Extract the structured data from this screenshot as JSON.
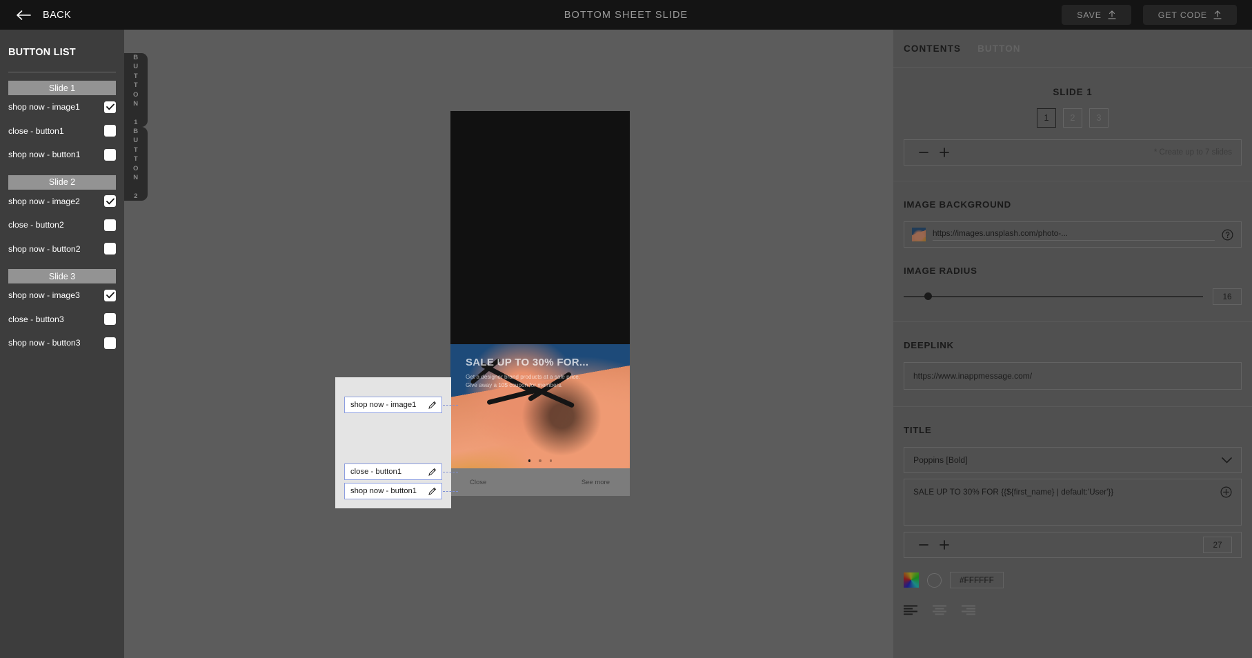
{
  "topbar": {
    "back_label": "BACK",
    "title": "BOTTOM SHEET SLIDE",
    "save_label": "SAVE",
    "get_code_label": "GET CODE"
  },
  "sidebar": {
    "title": "BUTTON LIST",
    "groups": [
      {
        "slide_label": "Slide 1",
        "items": [
          {
            "label": "shop now - image1",
            "checked": true
          },
          {
            "label": "close - button1",
            "checked": false
          },
          {
            "label": "shop now - button1",
            "checked": false
          }
        ]
      },
      {
        "slide_label": "Slide 2",
        "items": [
          {
            "label": "shop now - image2",
            "checked": true
          },
          {
            "label": "close - button2",
            "checked": false
          },
          {
            "label": "shop now - button2",
            "checked": false
          }
        ]
      },
      {
        "slide_label": "Slide 3",
        "items": [
          {
            "label": "shop now - image3",
            "checked": true
          },
          {
            "label": "close - button3",
            "checked": false
          },
          {
            "label": "shop now - button3",
            "checked": false
          }
        ]
      }
    ]
  },
  "vtabs": [
    {
      "label": "BUTTON 1"
    },
    {
      "label": "BUTTON 2"
    }
  ],
  "preview": {
    "headline": "SALE UP TO 30% FOR",
    "headline_suffix": "...",
    "body_line1": "Get a designer brand products at a sale price.",
    "body_line2": "Give away a 10$ coupon for members.",
    "close_label": "Close",
    "more_label": "See more",
    "dot_count": 3,
    "active_dot": 0
  },
  "popup": {
    "fields": [
      {
        "label": "shop now - image1"
      },
      {
        "label": "close - button1"
      },
      {
        "label": "shop now - button1"
      }
    ]
  },
  "right": {
    "tabs": [
      {
        "label": "CONTENTS",
        "active": true
      },
      {
        "label": "BUTTON",
        "active": false
      }
    ],
    "slide_section": {
      "title": "SLIDE 1",
      "numbers": [
        "1",
        "2",
        "3"
      ],
      "active_number": "1",
      "note": "* Create up to 7 slides"
    },
    "image_background": {
      "title": "IMAGE BACKGROUND",
      "url": "https://images.unsplash.com/photo-...",
      "help_icon": "question-circle-icon"
    },
    "image_radius": {
      "title": "IMAGE RADIUS",
      "value": "16"
    },
    "deeplink": {
      "title": "DEEPLINK",
      "url": "https://www.inappmessage.com/"
    },
    "title_section": {
      "title": "TITLE",
      "font": "Poppins [Bold]",
      "text": "SALE UP TO 30% FOR {{${first_name} | default:'User'}}",
      "size": "27",
      "hex": "#FFFFFF"
    }
  },
  "colors": {
    "topbar_bg": "#141414",
    "sidebar_bg": "#3d3d3d",
    "canvas_bg": "#5c5c5c",
    "right_panel_bg": "#6b6b6b",
    "slide_head_bg": "#939393",
    "field_border": "#8c9ee0",
    "accent_text": "#FFFFFF"
  }
}
